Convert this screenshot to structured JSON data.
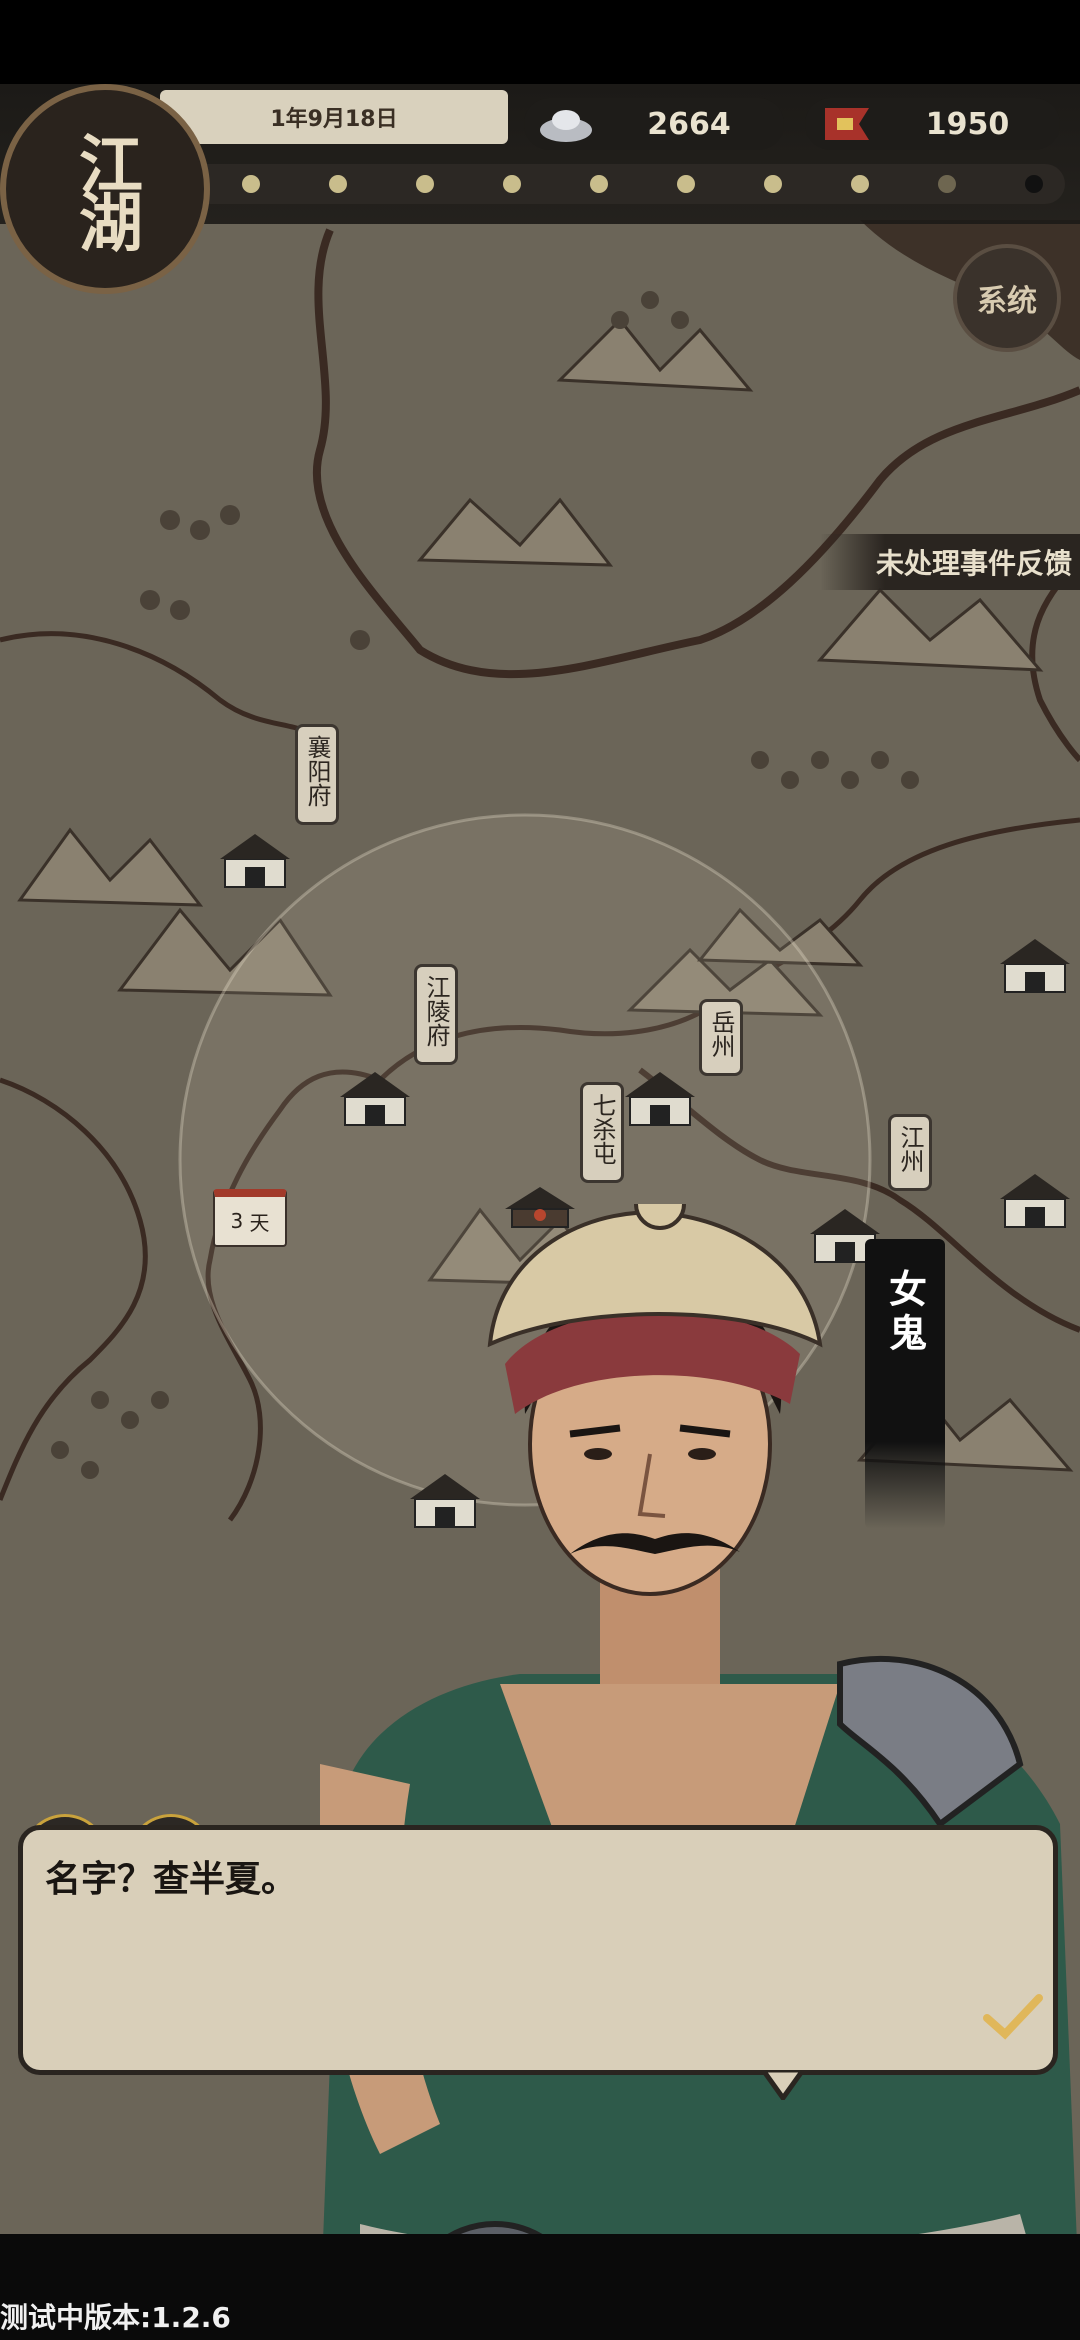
{
  "header": {
    "logo_text": "江湖",
    "date": "1年9月18日",
    "silver": "2664",
    "prestige": "1950"
  },
  "map": {
    "system_button": "系统",
    "event_feedback": "未处理事件反馈",
    "cities": [
      {
        "name": "襄阳府"
      },
      {
        "name": "江陵府"
      },
      {
        "name": "七杀屯"
      },
      {
        "name": "岳州"
      },
      {
        "name": "江州"
      }
    ],
    "day_marker": {
      "value": "3",
      "unit": "天"
    },
    "speaker_name": "女鬼"
  },
  "dialogue": {
    "text": "名字？查半夏。"
  },
  "footer": {
    "version": "测试中版本:1.2.6"
  },
  "colors": {
    "map_bg": "#6b6558",
    "dialog_bg": "#d9cfb9",
    "accent_gold": "#c9a23c"
  }
}
